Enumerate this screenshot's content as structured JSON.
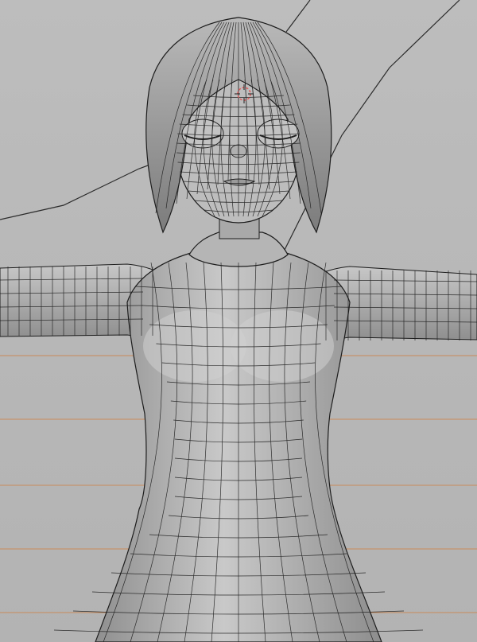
{
  "viewport": {
    "background": "#b9b9b9",
    "mesh_base": "#9d9d9d",
    "mesh_highlight": "#d8d8d8",
    "wire_color": "#1d1d1d",
    "floor_grid_color": "#c98a5a",
    "helper_line_color": "#2b2b2b",
    "cursor_color": "#e05a5a",
    "display_mode": "solid-with-wireframe",
    "icons": [
      "3d-cursor-icon"
    ]
  }
}
